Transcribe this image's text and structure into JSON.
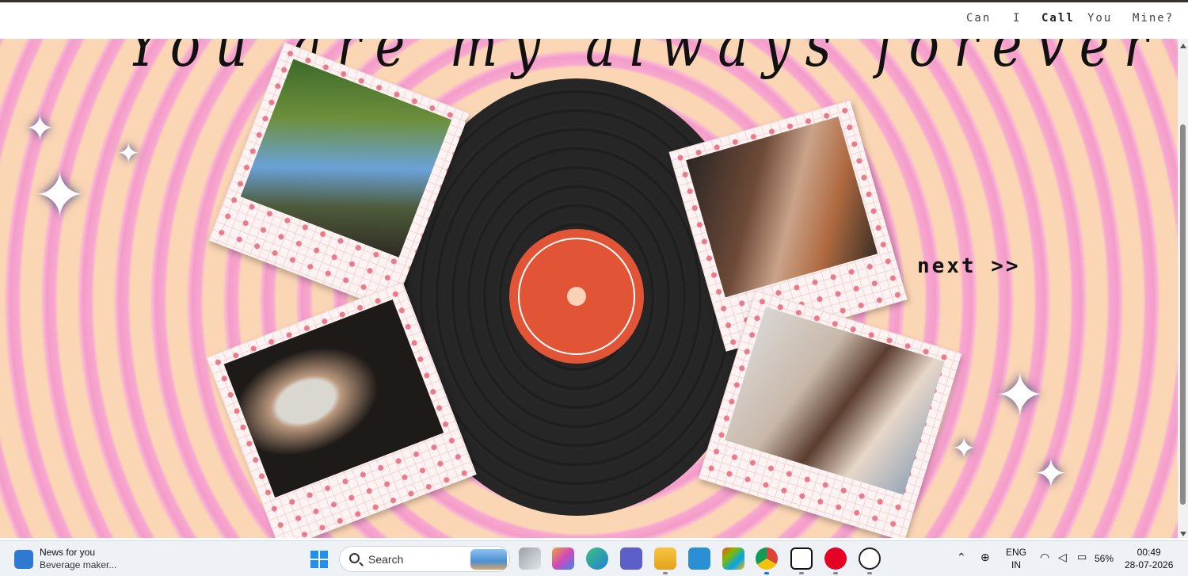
{
  "nav": {
    "words": [
      "Can",
      "I",
      "Call",
      "You",
      "Mine?"
    ],
    "active_index": 2
  },
  "page": {
    "script_heading": "You are my always forever",
    "next_label": "next >>"
  },
  "vinyl": {
    "label_color": "#e15436"
  },
  "polaroids": [
    "photo-couple-forest",
    "photo-face-masks",
    "photo-couple-closeup",
    "photo-couple-bed"
  ],
  "taskbar": {
    "news_title": "News for you",
    "news_sub": "Beverage maker...",
    "search_placeholder": "Search",
    "lang_1": "ENG",
    "lang_2": "IN",
    "battery": "56%",
    "time": "00:49",
    "date": "28-07-2026"
  },
  "colors": {
    "stripe_pink": "#f49cc9",
    "stripe_peach": "#fbd6b5",
    "accent": "#e15436"
  }
}
